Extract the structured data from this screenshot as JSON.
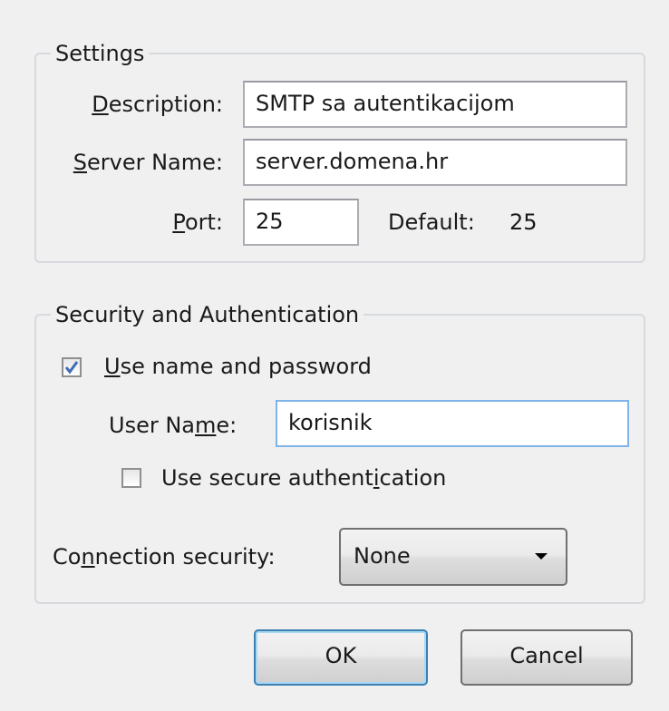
{
  "settings": {
    "legend": "Settings",
    "description": {
      "label_u": "D",
      "label_rest": "escription:",
      "value": "SMTP sa autentikacijom"
    },
    "server_name": {
      "label_u": "S",
      "label_rest": "erver Name:",
      "value": "server.domena.hr"
    },
    "port": {
      "label_u": "P",
      "label_rest": "ort:",
      "value": "25",
      "default_label": "Default:",
      "default_value": "25"
    }
  },
  "security": {
    "legend": "Security and Authentication",
    "use_name_password": {
      "checked": true,
      "label_u": "U",
      "label_rest": "se name and password"
    },
    "user_name": {
      "label_pre": "User Na",
      "label_u": "m",
      "label_rest": "e:",
      "value": "korisnik"
    },
    "secure_auth": {
      "checked": false,
      "label_pre": "Use secure authent",
      "label_u": "i",
      "label_rest": "cation"
    },
    "connection_security": {
      "label_pre": "Co",
      "label_u": "n",
      "label_rest": "nection security:",
      "selected": "None"
    }
  },
  "buttons": {
    "ok": "OK",
    "cancel": "Cancel"
  },
  "colors": {
    "checkmark": "#3d6db7",
    "focus_border": "#7eb4ea",
    "default_button_border": "#3c7fb1"
  }
}
